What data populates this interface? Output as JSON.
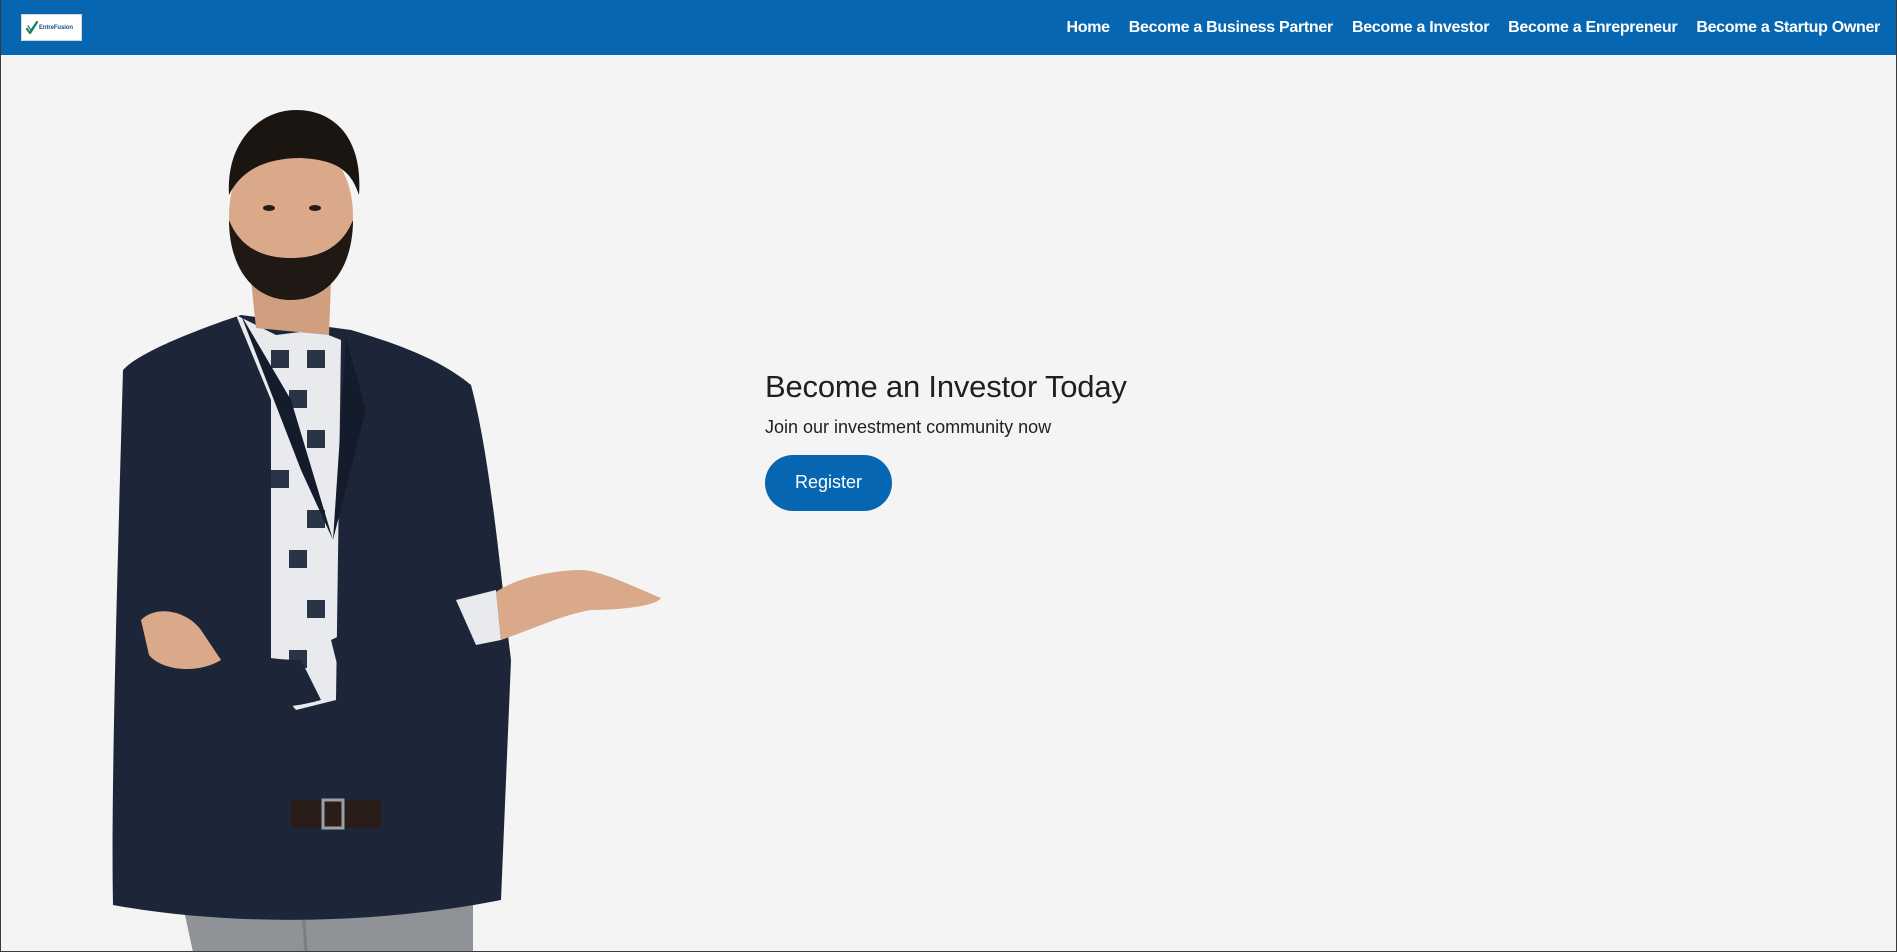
{
  "header": {
    "logo": {
      "text": "EntreFusion",
      "icon": "checkmark-logo-icon"
    },
    "nav": [
      {
        "label": "Home"
      },
      {
        "label": "Become a Business Partner"
      },
      {
        "label": "Become a Investor"
      },
      {
        "label": "Become a Enrepreneur"
      },
      {
        "label": "Become a Startup Owner"
      }
    ]
  },
  "hero": {
    "image": "man-in-blazer-presenting-photo",
    "title": "Become an Investor Today",
    "subtitle": "Join our investment community now",
    "cta_label": "Register"
  },
  "colors": {
    "primary": "#0766b1",
    "background": "#f4f4f4",
    "text": "#1f1f1f"
  }
}
